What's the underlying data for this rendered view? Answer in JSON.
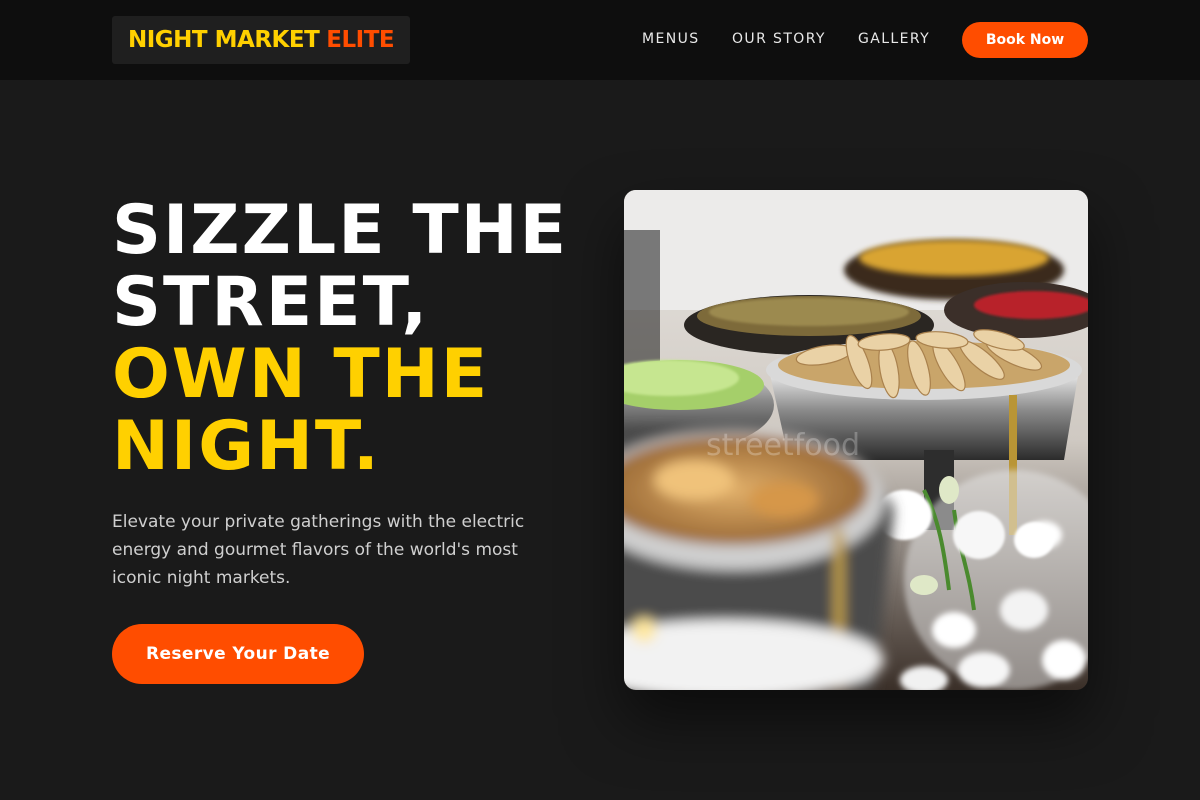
{
  "brand": {
    "part1": "NIGHT MARKET",
    "part2": "ELITE"
  },
  "nav": {
    "items": [
      "MENUS",
      "OUR STORY",
      "GALLERY"
    ],
    "cta": "Book Now"
  },
  "hero": {
    "line1": "SIZZLE THE",
    "line2": "STREET,",
    "line3": "OWN THE",
    "line4": "NIGHT.",
    "description": "Elevate your private gatherings with the electric energy and gourmet flavors of the world's most iconic night markets.",
    "cta": "Reserve Your Date"
  },
  "colors": {
    "background": "#1a1a1a",
    "header": "#0e0e0e",
    "accent_yellow": "#ffd000",
    "accent_orange": "#ff4d00",
    "body_text": "#cfcfcf"
  }
}
